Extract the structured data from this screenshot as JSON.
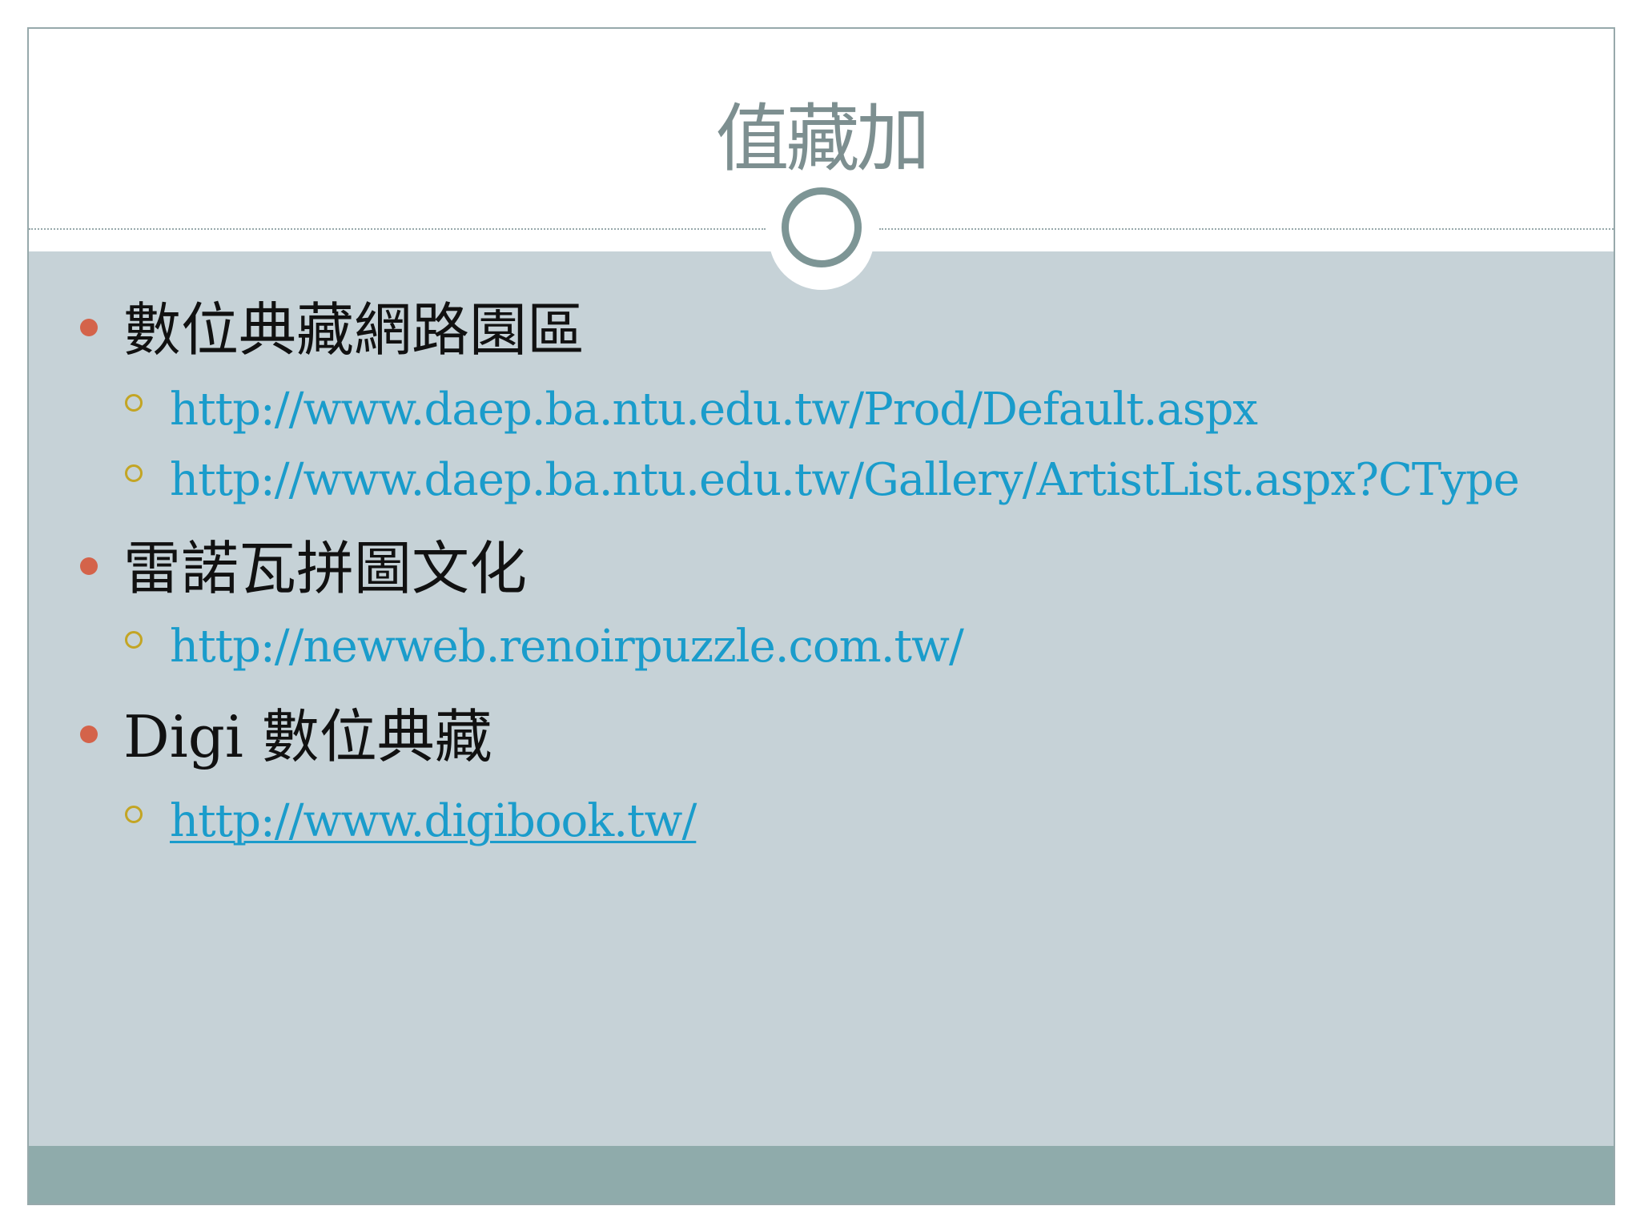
{
  "slide": {
    "title": "值藏加",
    "items": [
      {
        "text": "數位典藏網路園區",
        "sub": [
          "http://www.daep.ba.ntu.edu.tw/Prod/Default.aspx",
          "http://www.daep.ba.ntu.edu.tw/Gallery/ArtistList.aspx?CType"
        ]
      },
      {
        "text": "雷諾瓦拼圖文化",
        "sub": [
          "http://newweb.renoirpuzzle.com.tw/"
        ]
      },
      {
        "text": "Digi 數位典藏",
        "sub": [
          "http://www.digibook.tw/"
        ]
      }
    ]
  },
  "colors": {
    "title": "#7d8f90",
    "body_background": "#c6d2d7",
    "footer_band": "#8fabab",
    "bullet_primary": "#d4634a",
    "bullet_secondary": "#c3a524",
    "link": "#1a9ccb"
  }
}
